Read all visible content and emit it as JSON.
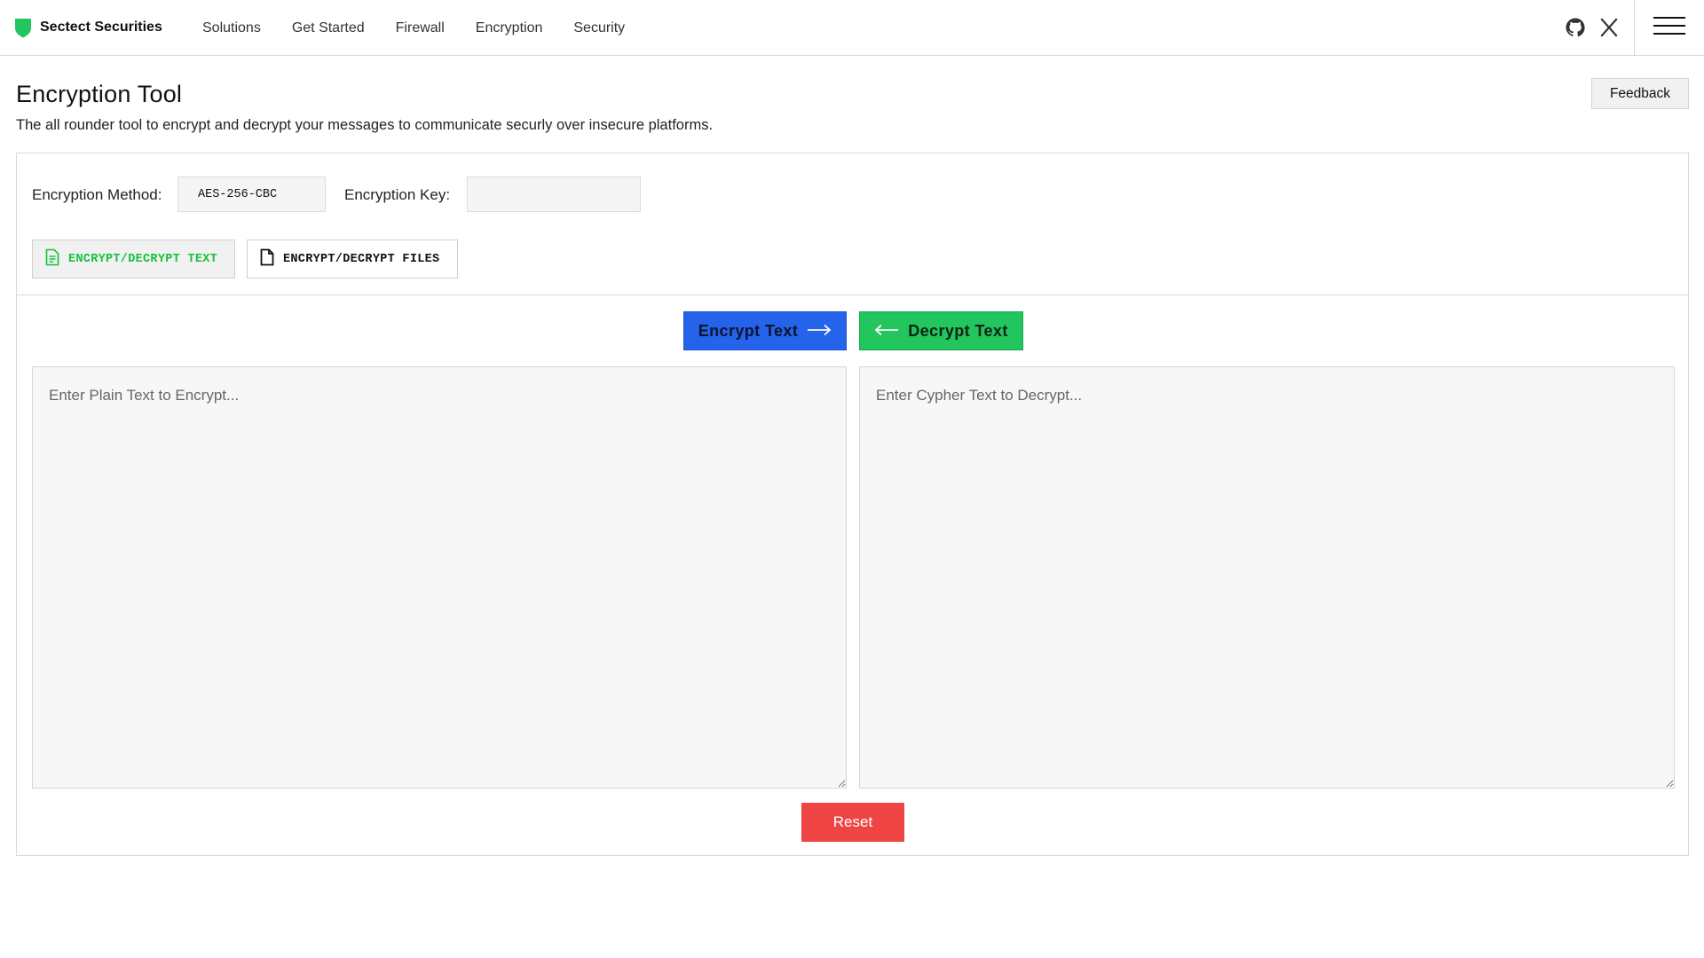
{
  "nav": {
    "brand": "Sectect Securities",
    "links": [
      "Solutions",
      "Get Started",
      "Firewall",
      "Encryption",
      "Security"
    ],
    "icons": [
      "github-icon",
      "x-twitter-icon",
      "menu-icon"
    ]
  },
  "header": {
    "title": "Encryption Tool",
    "subtitle": "The all rounder tool to encrypt and decrypt your messages to communicate securly over insecure platforms.",
    "feedback_label": "Feedback"
  },
  "settings": {
    "method_label": "Encryption Method:",
    "method_value": "AES-256-CBC",
    "key_label": "Encryption Key:",
    "key_value": ""
  },
  "modes": {
    "text_label": "ENCRYPT/DECRYPT TEXT",
    "files_label": "ENCRYPT/DECRYPT FILES",
    "active": "text"
  },
  "actions": {
    "encrypt_label": "Encrypt Text",
    "decrypt_label": "Decrypt Text",
    "reset_label": "Reset"
  },
  "inputs": {
    "plain_placeholder": "Enter Plain Text to Encrypt...",
    "cipher_placeholder": "Enter Cypher Text to Decrypt..."
  },
  "colors": {
    "brand_green": "#22c55e",
    "encrypt_blue": "#2563eb",
    "decrypt_green": "#22c55e",
    "reset_red": "#ef4444",
    "active_mode_text": "#16c13c"
  }
}
